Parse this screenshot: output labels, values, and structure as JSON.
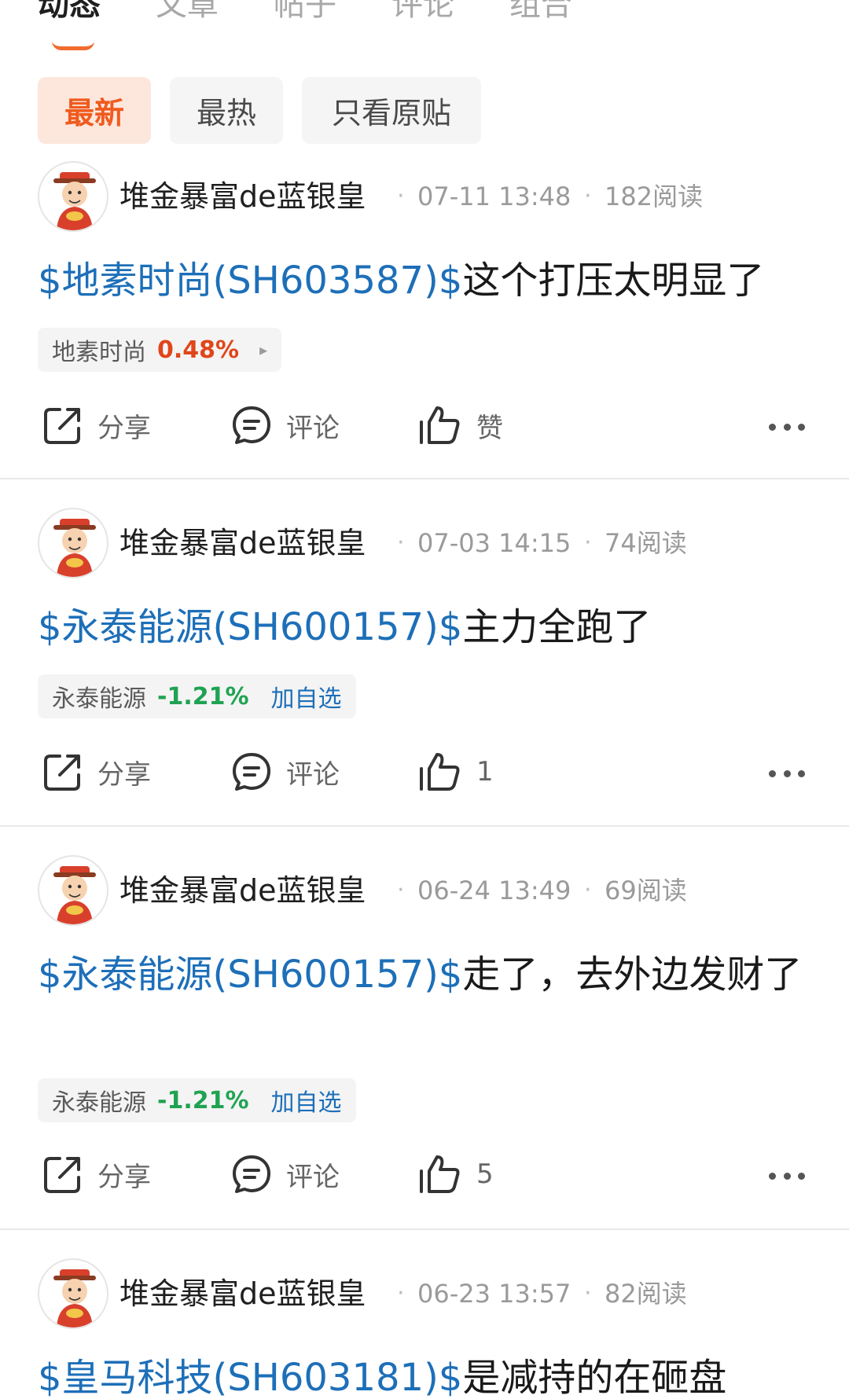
{
  "tabs": [
    {
      "label": "动态",
      "active": true
    },
    {
      "label": "文章",
      "active": false
    },
    {
      "label": "帖子",
      "active": false
    },
    {
      "label": "评论",
      "active": false
    },
    {
      "label": "组合",
      "active": false
    }
  ],
  "filters": [
    {
      "label": "最新",
      "active": true
    },
    {
      "label": "最热",
      "active": false
    },
    {
      "label": "只看原贴",
      "active": false
    }
  ],
  "colors": {
    "accent": "#ef5b1e",
    "link": "#1d6fb8",
    "up": "#e0461b",
    "down": "#1fa352"
  },
  "actions": {
    "share": "分享",
    "comment": "评论",
    "like_default": "赞"
  },
  "posts": [
    {
      "author": "堆金暴富de蓝银皇",
      "date": "07-11 13:48",
      "reads": "182阅读",
      "stock_tag": "$地素时尚(SH603587)$",
      "text": "这个打压太明显了",
      "chip_name": "地素时尚",
      "chip_pct": "0.48%",
      "chip_direction": "up",
      "chip_extra": "▸",
      "likes": "赞"
    },
    {
      "author": "堆金暴富de蓝银皇",
      "date": "07-03 14:15",
      "reads": "74阅读",
      "stock_tag": "$永泰能源(SH600157)$",
      "text": "主力全跑了",
      "chip_name": "永泰能源",
      "chip_pct": "-1.21%",
      "chip_direction": "down",
      "chip_extra": "加自选",
      "likes": "1"
    },
    {
      "author": "堆金暴富de蓝银皇",
      "date": "06-24 13:49",
      "reads": "69阅读",
      "stock_tag": "$永泰能源(SH600157)$",
      "text": "走了，去外边发财了",
      "chip_name": "永泰能源",
      "chip_pct": "-1.21%",
      "chip_direction": "down",
      "chip_extra": "加自选",
      "likes": "5"
    },
    {
      "author": "堆金暴富de蓝银皇",
      "date": "06-23 13:57",
      "reads": "82阅读",
      "stock_tag": "$皇马科技(SH603181)$",
      "text": "是减持的在砸盘"
    }
  ]
}
